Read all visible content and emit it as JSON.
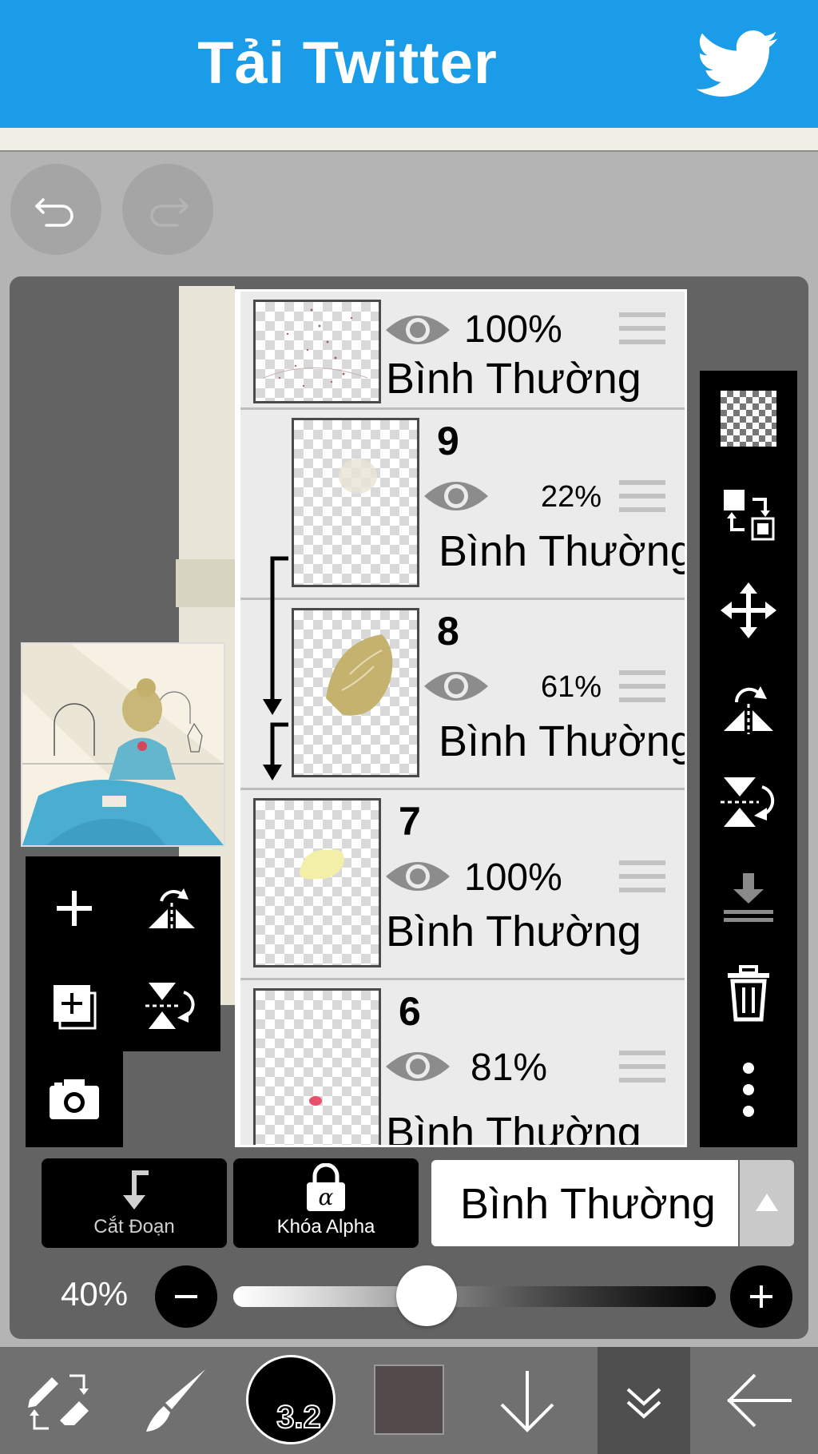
{
  "banner": {
    "title": "Tải Twitter",
    "icon": "twitter-bird-icon",
    "color": "#1b9ce8"
  },
  "history": {
    "undo_icon": "undo-icon",
    "redo_icon": "redo-icon"
  },
  "layers": [
    {
      "number": "",
      "opacity": "100%",
      "mode": "Bình Thường",
      "visible": true
    },
    {
      "number": "9",
      "opacity": "22%",
      "mode": "Bình Thường",
      "visible": true,
      "clipped": true
    },
    {
      "number": "8",
      "opacity": "61%",
      "mode": "Bình Thường",
      "visible": true,
      "clipped": true
    },
    {
      "number": "7",
      "opacity": "100%",
      "mode": "Bình Thường",
      "visible": true
    },
    {
      "number": "6",
      "opacity": "81%",
      "mode": "Bình Thường",
      "visible": true
    }
  ],
  "right_tools": [
    "transparency-icon",
    "layer-swap-icon",
    "move-icon",
    "flip-horizontal-icon",
    "flip-vertical-icon",
    "merge-down-icon",
    "trash-icon",
    "more-icon"
  ],
  "left_tools": [
    "add-layer-icon",
    "flip-horizontal-icon",
    "duplicate-layer-icon",
    "flip-vertical-icon",
    "camera-icon"
  ],
  "blend": {
    "clip_label": "Cắt Đoạn",
    "alpha_lock_label": "Khóa Alpha",
    "mode": "Bình Thường"
  },
  "opacity": {
    "label": "40%",
    "value": 40
  },
  "toolbar": {
    "brush_size": "3.2",
    "color": "#534a4b"
  }
}
